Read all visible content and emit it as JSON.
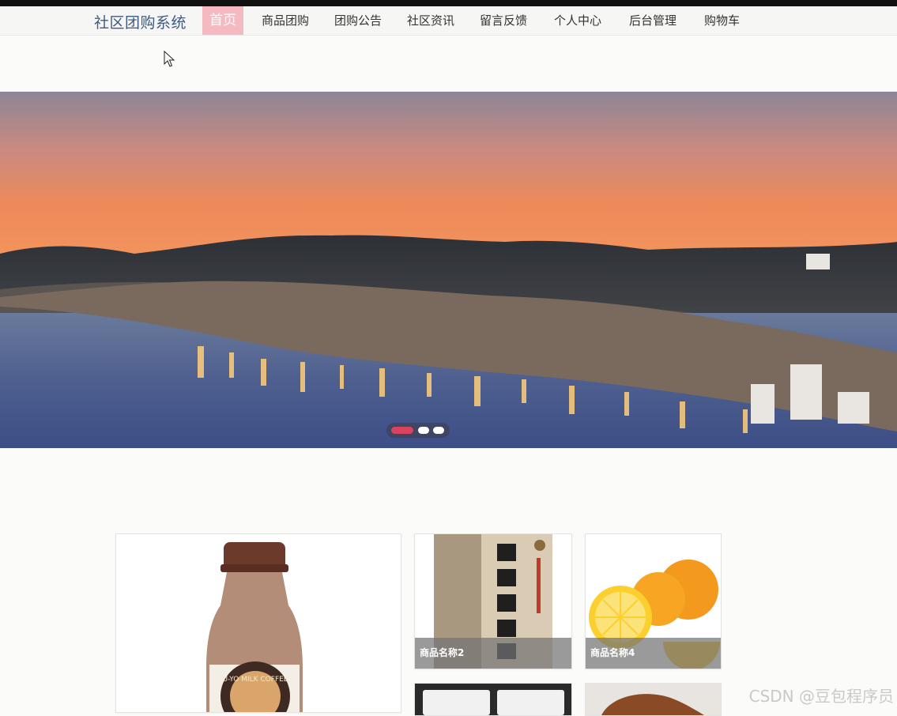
{
  "nav": {
    "brand": "社区团购系统",
    "items": [
      {
        "label": "首页",
        "active": true
      },
      {
        "label": "商品团购"
      },
      {
        "label": "团购公告"
      },
      {
        "label": "社区资讯"
      },
      {
        "label": "留言反馈"
      },
      {
        "label": "个人中心"
      },
      {
        "label": "后台管理"
      },
      {
        "label": "购物车"
      }
    ]
  },
  "carousel": {
    "slide_count": 3,
    "active_index": 0,
    "active_color": "#d9435f"
  },
  "products": [
    {
      "name": "",
      "image": "milk-coffee-bottle"
    },
    {
      "name": "商品名称2",
      "image": "book-cover"
    },
    {
      "name": "商品名称4",
      "image": "oranges"
    },
    {
      "name": "",
      "image": "packaged-goods"
    },
    {
      "name": "",
      "image": "leather-shoe"
    }
  ],
  "watermark": "CSDN @豆包程序员",
  "colors": {
    "brand": "#3e5a80",
    "active_nav_bg": "#f5b9c2"
  }
}
